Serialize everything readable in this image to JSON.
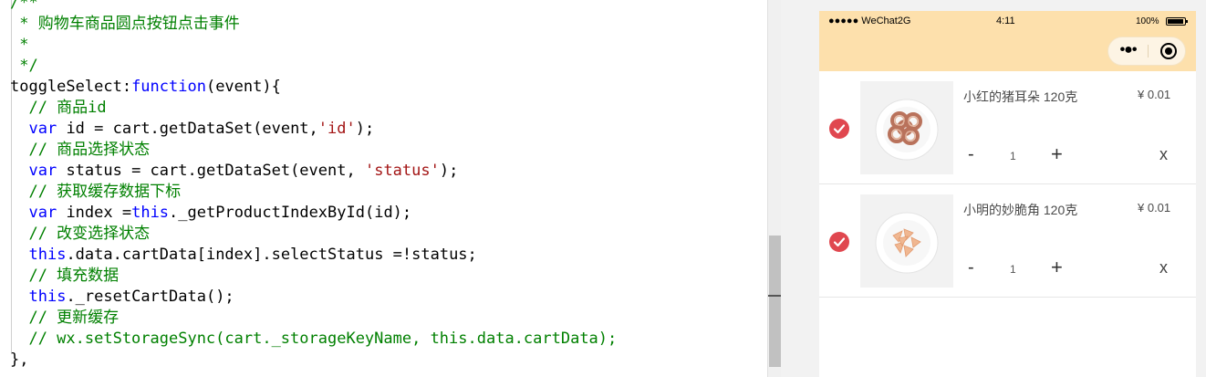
{
  "editor": {
    "lines": [
      [
        {
          "t": "/**",
          "c": "comment"
        }
      ],
      [
        {
          "t": " * 购物车商品圆点按钮点击事件",
          "c": "comment"
        }
      ],
      [
        {
          "t": " *",
          "c": "comment"
        }
      ],
      [
        {
          "t": " */",
          "c": "comment"
        }
      ],
      [
        {
          "t": "toggleSelect:",
          "c": "plain"
        },
        {
          "t": "function",
          "c": "kw"
        },
        {
          "t": "(event){",
          "c": "plain"
        }
      ],
      [
        {
          "t": "  // 商品id",
          "c": "comment"
        }
      ],
      [
        {
          "t": "  ",
          "c": "plain"
        },
        {
          "t": "var",
          "c": "kw"
        },
        {
          "t": " id = cart.getDataSet(event,",
          "c": "plain"
        },
        {
          "t": "'id'",
          "c": "str"
        },
        {
          "t": ");",
          "c": "plain"
        }
      ],
      [
        {
          "t": "  // 商品选择状态",
          "c": "comment"
        }
      ],
      [
        {
          "t": "  ",
          "c": "plain"
        },
        {
          "t": "var",
          "c": "kw"
        },
        {
          "t": " status = cart.getDataSet(event, ",
          "c": "plain"
        },
        {
          "t": "'status'",
          "c": "str"
        },
        {
          "t": ");",
          "c": "plain"
        }
      ],
      [
        {
          "t": "  // 获取缓存数据下标",
          "c": "comment"
        }
      ],
      [
        {
          "t": "  ",
          "c": "plain"
        },
        {
          "t": "var",
          "c": "kw"
        },
        {
          "t": " index =",
          "c": "plain"
        },
        {
          "t": "this",
          "c": "kw"
        },
        {
          "t": "._getProductIndexById(id);",
          "c": "plain"
        }
      ],
      [
        {
          "t": "  // 改变选择状态",
          "c": "comment"
        }
      ],
      [
        {
          "t": "  ",
          "c": "plain"
        },
        {
          "t": "this",
          "c": "kw"
        },
        {
          "t": ".data.cartData[index].selectStatus =!status;",
          "c": "plain"
        }
      ],
      [
        {
          "t": "  // 填充数据",
          "c": "comment"
        }
      ],
      [
        {
          "t": "  ",
          "c": "plain"
        },
        {
          "t": "this",
          "c": "kw"
        },
        {
          "t": "._resetCartData();",
          "c": "plain"
        }
      ],
      [
        {
          "t": "  // 更新缓存",
          "c": "comment"
        }
      ],
      [
        {
          "t": "  // wx.setStorageSync(cart._storageKeyName, this.data.cartData);",
          "c": "comment"
        }
      ],
      [
        {
          "t": "},",
          "c": "plain"
        }
      ]
    ]
  },
  "phone": {
    "carrier": "●●●●● WeChat2G",
    "time": "4:11",
    "battery": "100%",
    "capsule_more": "•●•",
    "accent_color": "#e0474f",
    "header_color": "#fde0ac",
    "items": [
      {
        "name": "小红的猪耳朵 120克",
        "price": "¥ 0.01",
        "minus": "-",
        "qty": "1",
        "plus": "+",
        "remove": "x",
        "selected": true
      },
      {
        "name": "小明的妙脆角 120克",
        "price": "¥ 0.01",
        "minus": "-",
        "qty": "1",
        "plus": "+",
        "remove": "x",
        "selected": true
      }
    ]
  }
}
